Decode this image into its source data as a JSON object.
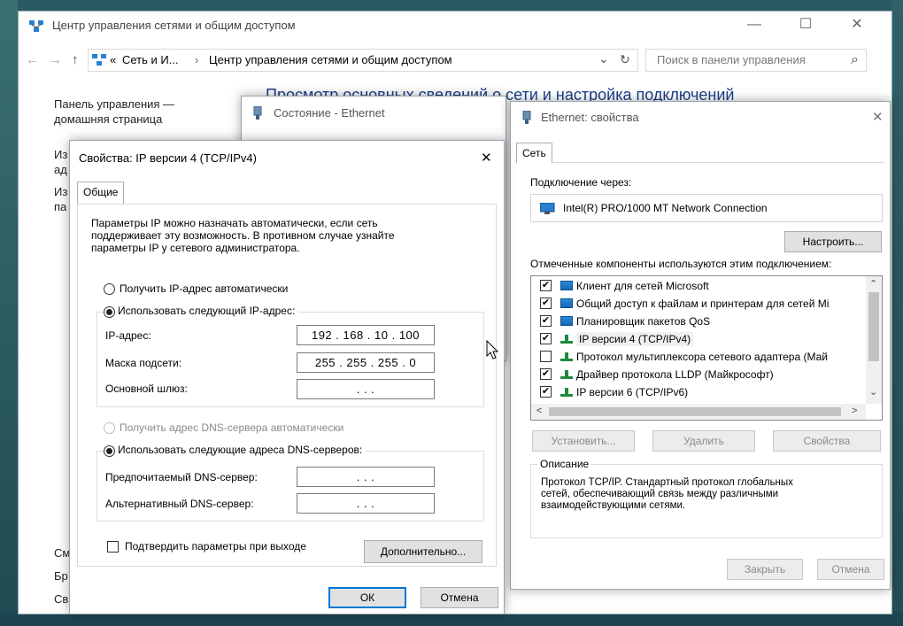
{
  "main_window": {
    "title": "Центр управления сетями и общим доступом",
    "controls": {
      "minimize": "—",
      "maximize": "☐",
      "close": "✕"
    },
    "address": {
      "back": "←",
      "forward": "→",
      "up": "↑",
      "prefix": "«",
      "crumb1": "Сеть и И...",
      "sep": "›",
      "crumb2": "Центр управления сетями и общим доступом",
      "dropdown": "⌄",
      "refresh": "↻"
    },
    "search": {
      "placeholder": "Поиск в панели управления",
      "icon": "⌕"
    },
    "heading": "Просмотр основных сведений о сети и настройка подключений",
    "sidebar": {
      "home_link": "Панель управления —\nдомашняя страница",
      "item1_a": "Из",
      "item1_b": "ад",
      "item2_a": "Из",
      "item2_b": "па",
      "bottom_1": "См",
      "bottom_2": "Бр",
      "bottom_3": "Св"
    }
  },
  "status_window": {
    "title": "Состояние - Ethernet"
  },
  "ipv4_dialog": {
    "title": "Свойства: IP версии 4 (TCP/IPv4)",
    "close": "✕",
    "tab": "Общие",
    "description": "Параметры IP можно назначать автоматически, если сеть\nподдерживает эту возможность. В противном случае узнайте\nпараметры IP у сетевого администратора.",
    "radio_auto_ip": "Получить IP-адрес автоматически",
    "radio_manual_ip": "Использовать следующий IP-адрес:",
    "ip_label": "IP-адрес:",
    "ip_value": "192 . 168 .  10  . 100",
    "mask_label": "Маска подсети:",
    "mask_value": "255 . 255 . 255 .  0",
    "gateway_label": "Основной шлюз:",
    "gateway_value": ".      .      .",
    "radio_auto_dns": "Получить адрес DNS-сервера автоматически",
    "radio_manual_dns": "Использовать следующие адреса DNS-серверов:",
    "dns1_label": "Предпочитаемый DNS-сервер:",
    "dns1_value": ".      .      .",
    "dns2_label": "Альтернативный DNS-сервер:",
    "dns2_value": ".      .      .",
    "validate_label": "Подтвердить параметры при выходе",
    "advanced_button": "Дополнительно...",
    "ok_button": "ОК",
    "cancel_button": "Отмена"
  },
  "ethernet_props": {
    "title": "Ethernet: свойства",
    "close": "✕",
    "tab": "Сеть",
    "connect_using_label": "Подключение через:",
    "adapter": "Intel(R) PRO/1000 MT Network Connection",
    "configure_button": "Настроить...",
    "components_label": "Отмеченные компоненты используются этим подключением:",
    "components": [
      {
        "label": "Клиент для сетей Microsoft",
        "checked": "✔",
        "icon": "network-client-icon"
      },
      {
        "label": "Общий доступ к файлам и принтерам для сетей Mi",
        "checked": "✔",
        "icon": "network-client-icon"
      },
      {
        "label": "Планировщик пакетов QoS",
        "checked": "✔",
        "icon": "network-client-icon"
      },
      {
        "label": "IP версии 4 (TCP/IPv4)",
        "checked": "✔",
        "icon": "protocol-icon"
      },
      {
        "label": "Протокол мультиплексора сетевого адаптера (Май",
        "checked": "",
        "icon": "protocol-icon"
      },
      {
        "label": "Драйвер протокола LLDP (Майкрософт)",
        "checked": "✔",
        "icon": "protocol-icon"
      },
      {
        "label": "IP версии 6 (TCP/IPv6)",
        "checked": "✔",
        "icon": "protocol-icon"
      }
    ],
    "scroll_up": "⌃",
    "scroll_down": "⌄",
    "scroll_left": "<",
    "scroll_right": ">",
    "install_button": "Установить...",
    "remove_button": "Удалить",
    "properties_button": "Свойства",
    "description_group": "Описание",
    "description_text": "Протокол TCP/IP. Стандартный протокол глобальных\nсетей, обеспечивающий связь между различными\nвзаимодействующими сетями.",
    "close_button": "Закрыть",
    "cancel_button": "Отмена"
  }
}
